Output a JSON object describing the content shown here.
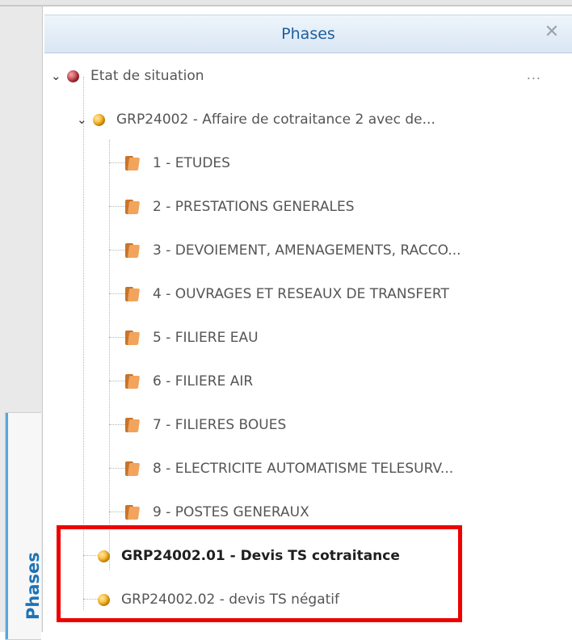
{
  "panel": {
    "title": "Phases",
    "side_tab_label": "Phases"
  },
  "tree": {
    "root": {
      "label": "Etat de situation",
      "status": "red",
      "more": "..."
    },
    "project": {
      "label": "GRP24002 - Affaire de cotraitance 2 avec de...",
      "status": "orange"
    },
    "phases": [
      {
        "label": "1 - ETUDES"
      },
      {
        "label": "2 - PRESTATIONS GENERALES"
      },
      {
        "label": "3 - DEVOIEMENT, AMENAGEMENTS, RACCO..."
      },
      {
        "label": "4 - OUVRAGES ET RESEAUX DE TRANSFERT"
      },
      {
        "label": "5 - FILIERE EAU"
      },
      {
        "label": "6 - FILIERE AIR"
      },
      {
        "label": "7 - FILIERES BOUES"
      },
      {
        "label": "8 - ELECTRICITE AUTOMATISME TELESURV..."
      },
      {
        "label": "9 - POSTES GENERAUX"
      }
    ],
    "quotes": [
      {
        "label": "GRP24002.01 - Devis TS cotraitance",
        "status": "orange",
        "bold": true
      },
      {
        "label": "GRP24002.02 - devis TS négatif",
        "status": "orange",
        "bold": false
      }
    ]
  },
  "colors": {
    "accent_blue": "#1d73b5",
    "highlight_red": "#ee0000",
    "status_red": "#b02a36",
    "status_orange": "#f6a500"
  }
}
